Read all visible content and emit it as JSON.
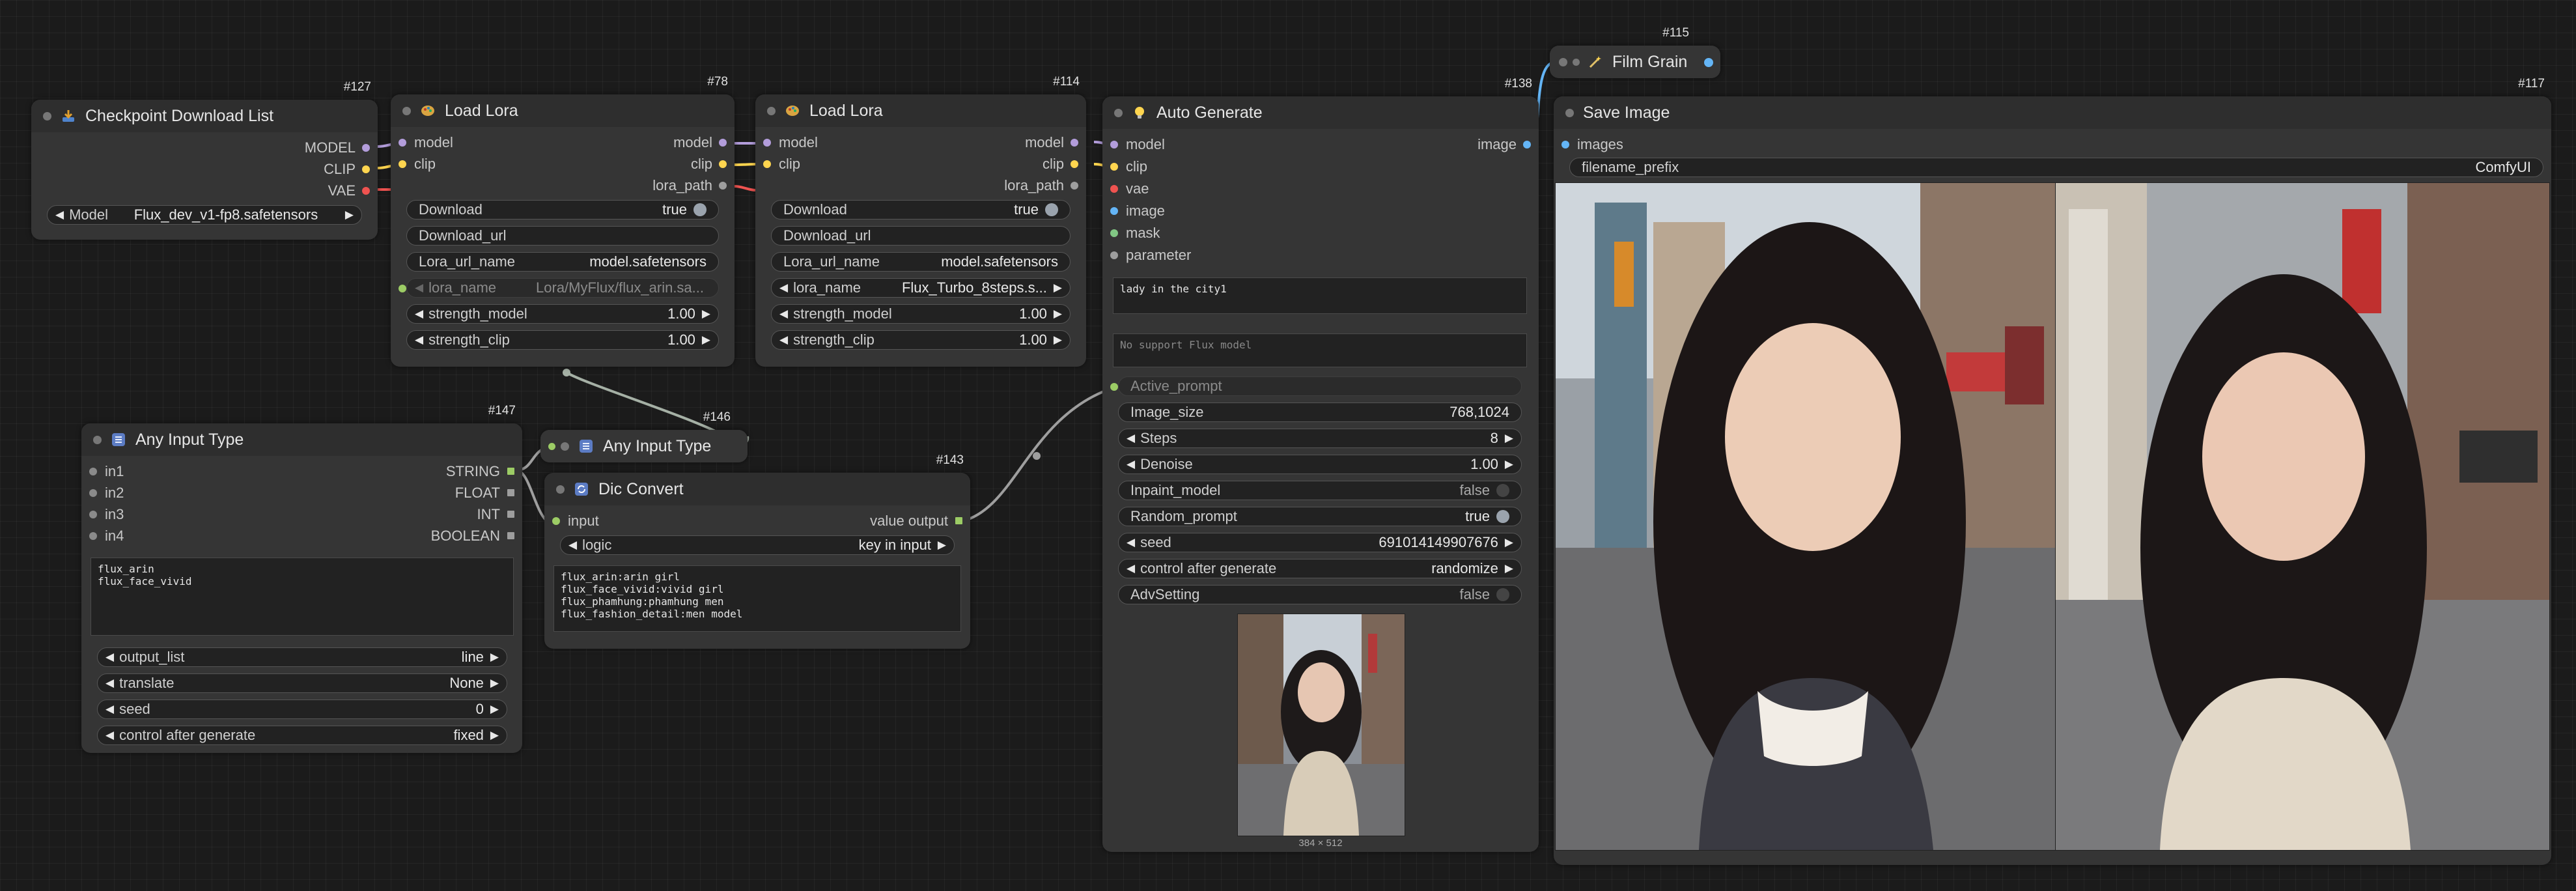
{
  "colors": {
    "model": "#b39ddb",
    "clip": "#ffd54f",
    "vae": "#ef5350",
    "string": "#9ccc65",
    "image": "#64b5f6",
    "mask": "#81c784",
    "neutral": "#9e9e9e",
    "link_green": "#a5d6a7",
    "link_gray": "#9e9e9e"
  },
  "checkpoint_list": {
    "id": "#127",
    "title": "Checkpoint Download List",
    "icon": "download-icon",
    "outputs": [
      "MODEL",
      "CLIP",
      "VAE"
    ],
    "model_label": "Model",
    "model_value": "Flux_dev_v1-fp8.safetensors"
  },
  "lora1": {
    "id": "#78",
    "title": "Load Lora",
    "icon": "palette-icon",
    "inputs": [
      "model",
      "clip"
    ],
    "outputs": [
      "model",
      "clip",
      "lora_path"
    ],
    "download_label": "Download",
    "download_value": "true",
    "download_url_label": "Download_url",
    "lora_url_name_label": "Lora_url_name",
    "lora_url_name_value": "model.safetensors",
    "lora_name_label": "lora_name",
    "lora_name_value": "Lora/MyFlux/flux_arin.sa...",
    "strength_model_label": "strength_model",
    "strength_model_value": "1.00",
    "strength_clip_label": "strength_clip",
    "strength_clip_value": "1.00"
  },
  "lora2": {
    "id": "#114",
    "title": "Load Lora",
    "icon": "palette-icon",
    "inputs": [
      "model",
      "clip"
    ],
    "outputs": [
      "model",
      "clip",
      "lora_path"
    ],
    "download_label": "Download",
    "download_value": "true",
    "download_url_label": "Download_url",
    "lora_url_name_label": "Lora_url_name",
    "lora_url_name_value": "model.safetensors",
    "lora_name_label": "lora_name",
    "lora_name_value": "Flux_Turbo_8steps.s...",
    "strength_model_label": "strength_model",
    "strength_model_value": "1.00",
    "strength_clip_label": "strength_clip",
    "strength_clip_value": "1.00"
  },
  "auto_generate": {
    "id": "#138",
    "title": "Auto Generate",
    "icon": "bulb-icon",
    "inputs": [
      "model",
      "clip",
      "vae",
      "image",
      "mask",
      "parameter"
    ],
    "output": "image",
    "prompt_text": "lady in the city1",
    "negative_placeholder": "No support Flux model",
    "active_prompt_label": "Active_prompt",
    "image_size_label": "Image_size",
    "image_size_value": "768,1024",
    "steps_label": "Steps",
    "steps_value": "8",
    "denoise_label": "Denoise",
    "denoise_value": "1.00",
    "inpaint_label": "Inpaint_model",
    "inpaint_value": "false",
    "random_prompt_label": "Random_prompt",
    "random_prompt_value": "true",
    "seed_label": "seed",
    "seed_value": "691014149907676",
    "control_label": "control after generate",
    "control_value": "randomize",
    "adv_label": "AdvSetting",
    "adv_value": "false",
    "preview_caption": "384 × 512"
  },
  "film_grain": {
    "id": "#115",
    "title": "Film Grain",
    "icon": "wand-icon"
  },
  "save_image": {
    "id": "#117",
    "title": "Save Image",
    "input": "images",
    "filename_label": "filename_prefix",
    "filename_value": "ComfyUI"
  },
  "any_input_147": {
    "id": "#147",
    "title": "Any Input Type",
    "icon": "grid-icon",
    "inputs": [
      "in1",
      "in2",
      "in3",
      "in4"
    ],
    "outputs": [
      "STRING",
      "FLOAT",
      "INT",
      "BOOLEAN"
    ],
    "text": "flux_arin\nflux_face_vivid",
    "output_list_label": "output_list",
    "output_list_value": "line",
    "translate_label": "translate",
    "translate_value": "None",
    "seed_label": "seed",
    "seed_value": "0",
    "control_label": "control after generate",
    "control_value": "fixed"
  },
  "any_input_146": {
    "id": "#146",
    "title": "Any Input Type",
    "icon": "grid-icon"
  },
  "dic_convert": {
    "id": "#143",
    "title": "Dic Convert",
    "icon": "refresh-icon",
    "input": "input",
    "output": "value output",
    "logic_label": "logic",
    "logic_value": "key in input",
    "text": "flux_arin:arin girl\nflux_face_vivid:vivid girl\nflux_phamhung:phamhung men\nflux_fashion_detail:men model"
  }
}
